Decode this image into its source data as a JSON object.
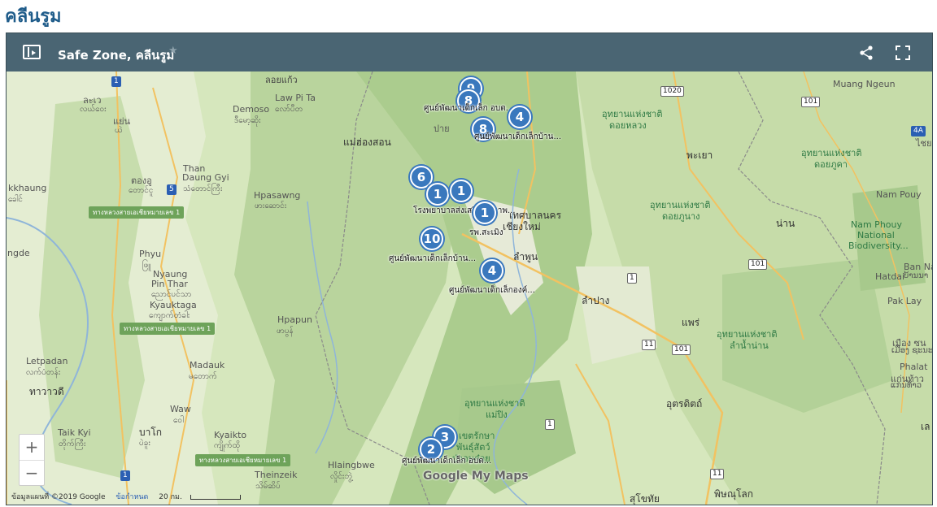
{
  "page": {
    "title": "คลีนรูม"
  },
  "map": {
    "title": "Safe Zone, คลีนรูม",
    "star_icon": "star-icon",
    "share_icon": "share-icon",
    "fullscreen_icon": "fullscreen-icon",
    "sidebar_toggle_icon": "sidebar-toggle-icon"
  },
  "places": [
    {
      "id": "laokai",
      "text": "ลอยแก้ว"
    },
    {
      "id": "lawpita",
      "text": "Law Pi Ta"
    },
    {
      "id": "lawpita_my",
      "text": "လော်ပီတ"
    },
    {
      "id": "demoso",
      "text": "Demoso"
    },
    {
      "id": "demoso_my",
      "text": "ဒီမော့ဆိုး"
    },
    {
      "id": "laya",
      "text": "ละเว"
    },
    {
      "id": "laya_my",
      "text": "လယ်ဝေး"
    },
    {
      "id": "yen",
      "text": "แย่น"
    },
    {
      "id": "yen_my",
      "text": "ယဲ"
    },
    {
      "id": "tong",
      "text": "ตองอู"
    },
    {
      "id": "tong_my",
      "text": "တောင်ငူ"
    },
    {
      "id": "than",
      "text": "Than"
    },
    {
      "id": "daung",
      "text": "Daung Gyi"
    },
    {
      "id": "daung_my",
      "text": "သံတောင်ကြီး"
    },
    {
      "id": "kkhaung",
      "text": "kkhaung"
    },
    {
      "id": "kkhaung_my",
      "text": "ခေါင်"
    },
    {
      "id": "hpasawng",
      "text": "Hpasawng"
    },
    {
      "id": "hpasawng_my",
      "text": "ဖားဆောင်း"
    },
    {
      "id": "phyu",
      "text": "Phyu"
    },
    {
      "id": "phyu_my",
      "text": "ဖြူ"
    },
    {
      "id": "nyaung",
      "text": "Nyaung"
    },
    {
      "id": "pinthar",
      "text": "Pin Thar"
    },
    {
      "id": "pinthar_my",
      "text": "ညောင်ပင်သာ"
    },
    {
      "id": "kyauktaga",
      "text": "Kyauktaga"
    },
    {
      "id": "kyauktaga_my",
      "text": "ကျောက်တံခါး"
    },
    {
      "id": "ngde",
      "text": "ngde"
    },
    {
      "id": "hpapun",
      "text": "Hpapun"
    },
    {
      "id": "hpapun_my",
      "text": "ဖာပွန်"
    },
    {
      "id": "letpadan",
      "text": "Letpadan"
    },
    {
      "id": "letpadan_my",
      "text": "လက်ပံတန်း"
    },
    {
      "id": "tharrawaddy",
      "text": "ทาวาวดี"
    },
    {
      "id": "madauk",
      "text": "Madauk"
    },
    {
      "id": "madauk_my",
      "text": "မတောက်"
    },
    {
      "id": "waw",
      "text": "Waw"
    },
    {
      "id": "waw_my",
      "text": "ဝေါ"
    },
    {
      "id": "taikkyi",
      "text": "Taik Kyi"
    },
    {
      "id": "taikkyi_my",
      "text": "တိုက်ကြီး"
    },
    {
      "id": "bago",
      "text": "บาโก"
    },
    {
      "id": "bago_my",
      "text": "ပဲခူး"
    },
    {
      "id": "kyaikto",
      "text": "Kyaikto"
    },
    {
      "id": "kyaikto_my",
      "text": "ကျိုက်ထို"
    },
    {
      "id": "theinzeik",
      "text": "Theinzeik"
    },
    {
      "id": "theinzeik_my",
      "text": "သိမ်ဆိပ်"
    },
    {
      "id": "hlaingbwe",
      "text": "Hlaingbwe"
    },
    {
      "id": "hlaingbwe_my",
      "text": "လှိုင်းဘွဲ့"
    },
    {
      "id": "maehongson",
      "text": "แม่ฮ่องสอน"
    },
    {
      "id": "pai",
      "text": "ปาย"
    },
    {
      "id": "chiangmai1",
      "text": "เทศบาลนคร"
    },
    {
      "id": "chiangmai2",
      "text": "เชียงใหม่"
    },
    {
      "id": "lamphun",
      "text": "ลำพูน"
    },
    {
      "id": "lampang",
      "text": "ลำปาง"
    },
    {
      "id": "phayao",
      "text": "พะเยา"
    },
    {
      "id": "nan",
      "text": "น่าน"
    },
    {
      "id": "phrae",
      "text": "แพร่"
    },
    {
      "id": "uttaradit",
      "text": "อุตรดิตถ์"
    },
    {
      "id": "phitsanulok",
      "text": "พิษณุโลก"
    },
    {
      "id": "sukhothai",
      "text": "สุโขทัย"
    },
    {
      "id": "muangngeun",
      "text": "Muang Ngeun"
    },
    {
      "id": "xaignabouli",
      "text": "ไชย"
    },
    {
      "id": "nampouy",
      "text": "Nam Pouy"
    },
    {
      "id": "hatdai",
      "text": "Hatdai"
    },
    {
      "id": "banna",
      "text": "Ban Na"
    },
    {
      "id": "banna_th",
      "text": "ບ້ານນາ"
    },
    {
      "id": "paklay",
      "text": "Pak Lay"
    },
    {
      "id": "muangs",
      "text": "เมือง ซน"
    },
    {
      "id": "muangs_lo",
      "text": "ເມືອງ ຊະນະ"
    },
    {
      "id": "phalat",
      "text": "Phalat"
    },
    {
      "id": "phalat_th",
      "text": "แก่นท้าว"
    },
    {
      "id": "phalat_lo",
      "text": "ແກ່ນທ້າວ"
    },
    {
      "id": "right_l",
      "text": "เล"
    }
  ],
  "parks": [
    {
      "id": "p1a",
      "text": "อุทยานแห่งชาติ"
    },
    {
      "id": "p1b",
      "text": "ดอยหลวง"
    },
    {
      "id": "p2a",
      "text": "อุทยานแห่งชาติ"
    },
    {
      "id": "p2b",
      "text": "ดอยภูคา"
    },
    {
      "id": "p3a",
      "text": "อุทยานแห่งชาติ"
    },
    {
      "id": "p3b",
      "text": "ดอยภูนาง"
    },
    {
      "id": "p4a",
      "text": "อุทยานแห่งชาติ"
    },
    {
      "id": "p4b",
      "text": "ลำน้ำน่าน"
    },
    {
      "id": "p5a",
      "text": "อุทยานแห่งชาติ"
    },
    {
      "id": "p5b",
      "text": "แม่ปิง"
    },
    {
      "id": "p6a",
      "text": "Nam Phouy"
    },
    {
      "id": "p6b",
      "text": "National"
    },
    {
      "id": "p6c",
      "text": "Biodiversity..."
    },
    {
      "id": "p7a",
      "text": "เขตรักษา"
    },
    {
      "id": "p7b",
      "text": "พันธุ์สัตว์"
    },
    {
      "id": "p7c",
      "text": "ป่าอมก๋อย"
    }
  ],
  "highways": [
    {
      "id": "hw1",
      "text": "ทางหลวงสายเอเชียหมายเลข 1"
    },
    {
      "id": "hw2",
      "text": "ทางหลวงสายเอเชียหมายเลข 1"
    },
    {
      "id": "hw3",
      "text": "ทางหลวงสายเอเชียหมายเลข 1"
    }
  ],
  "shields": [
    {
      "id": "s1",
      "text": "1"
    },
    {
      "id": "s5",
      "text": "5"
    },
    {
      "id": "s1020",
      "text": "1020"
    },
    {
      "id": "s101a",
      "text": "101"
    },
    {
      "id": "s4a",
      "text": "4A"
    },
    {
      "id": "s101b",
      "text": "101"
    },
    {
      "id": "s1b",
      "text": "1"
    },
    {
      "id": "s11a",
      "text": "11"
    },
    {
      "id": "s101c",
      "text": "101"
    },
    {
      "id": "s1c",
      "text": "1"
    },
    {
      "id": "s11b",
      "text": "11"
    },
    {
      "id": "s1d",
      "text": "1"
    }
  ],
  "markers": [
    {
      "id": "m_top1",
      "count": "9",
      "label": ""
    },
    {
      "id": "m_top2",
      "count": "8",
      "label": "ศูนย์พัฒนาเด็กเล็ก อบต..."
    },
    {
      "id": "m_4a",
      "count": "4",
      "label": ""
    },
    {
      "id": "m_8b",
      "count": "8",
      "label": "ศูนย์พัฒนาเด็กเล็กบ้าน..."
    },
    {
      "id": "m_6",
      "count": "6",
      "label": ""
    },
    {
      "id": "m_1a",
      "count": "1",
      "label": "โรงพยาบาลส่งเสริมสุขภาพ..."
    },
    {
      "id": "m_1b",
      "count": "1",
      "label": ""
    },
    {
      "id": "m_1c",
      "count": "1",
      "label": "รพ.สะเมิง"
    },
    {
      "id": "m_10",
      "count": "10",
      "label": "ศูนย์พัฒนาเด็กเล็กบ้าน..."
    },
    {
      "id": "m_4b",
      "count": "4",
      "label": "ศูนย์พัฒนาเด็กเล็กองค์..."
    },
    {
      "id": "m_3",
      "count": "3",
      "label": ""
    },
    {
      "id": "m_2",
      "count": "2",
      "label": "ศูนย์พัฒนาเด็กเล็ก อบต..."
    }
  ],
  "controls": {
    "zoom_in": "+",
    "zoom_out": "−"
  },
  "footer": {
    "copyright": "ข้อมูลแผนที่ ©2019 Google",
    "terms": "ข้อกำหนด",
    "scale": "20 กม."
  },
  "logo": "Google My Maps"
}
